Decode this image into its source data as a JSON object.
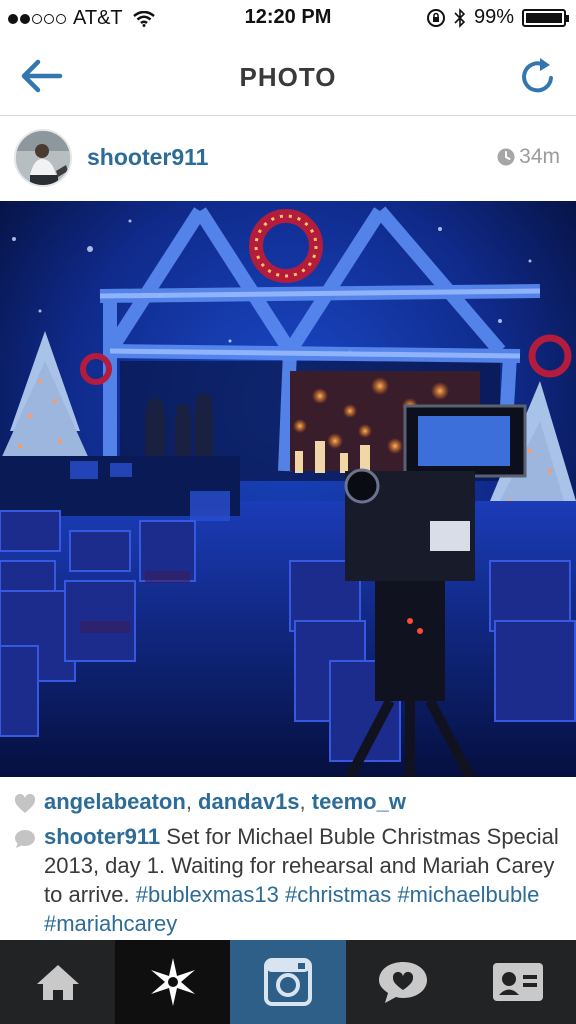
{
  "status_bar": {
    "carrier": "AT&T",
    "time": "12:20 PM",
    "battery": "99%",
    "battery_level": 0.99,
    "signal_bars_filled": 2,
    "signal_bars_total": 5
  },
  "nav": {
    "title": "PHOTO",
    "back_icon": "arrow-left-icon",
    "refresh_icon": "refresh-icon"
  },
  "post": {
    "username": "shooter911",
    "timestamp": "34m",
    "clock_icon": "clock-icon"
  },
  "likes": {
    "icon": "heart-icon",
    "users": [
      "angelabeaton",
      "dandav1s",
      "teemo_w"
    ]
  },
  "caption": {
    "icon": "comment-icon",
    "user": "shooter911",
    "text": "Set for Michael Buble Christmas Special 2013, day 1. Waiting for rehearsal and Mariah Carey to arrive.",
    "hashtags": [
      "#bublexmas13",
      "#christmas",
      "#michaelbuble",
      "#mariahcarey"
    ]
  },
  "tab_bar": {
    "tabs": [
      {
        "name": "home",
        "icon": "home-icon"
      },
      {
        "name": "explore",
        "icon": "explore-star-icon"
      },
      {
        "name": "camera",
        "icon": "camera-icon",
        "active": true
      },
      {
        "name": "activity",
        "icon": "activity-heart-icon"
      },
      {
        "name": "profile",
        "icon": "profile-card-icon"
      }
    ]
  },
  "colors": {
    "link_blue": "#2d6c97",
    "active_tab": "#2e5f88",
    "tab_bar_bg": "#222325",
    "nav_icon_blue": "#3377b0"
  }
}
